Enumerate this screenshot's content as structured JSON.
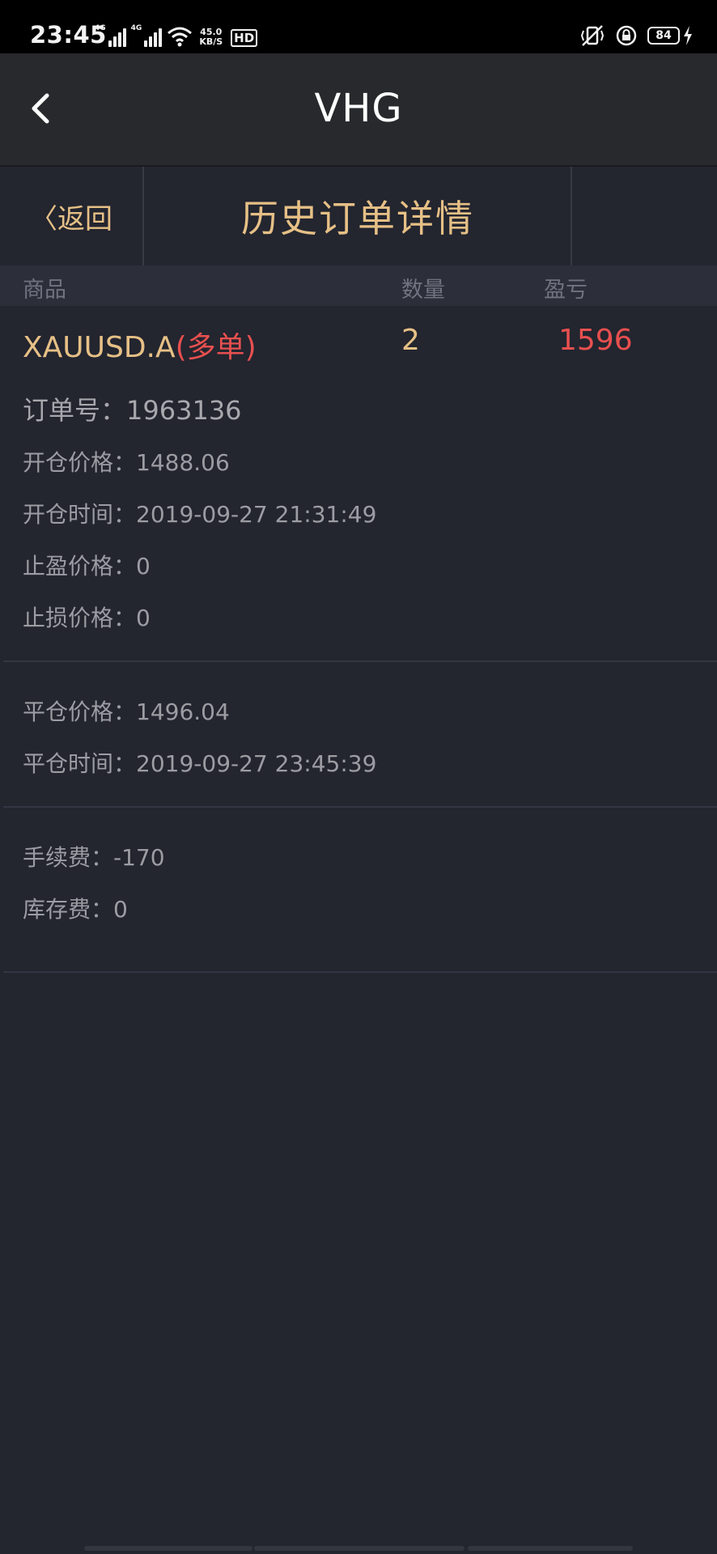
{
  "status_bar": {
    "time": "23:45",
    "signal_label_1": "4G",
    "signal_label_2": "4G",
    "net_speed_value": "45.0",
    "net_speed_unit": "KB/S",
    "hd_label": "HD",
    "battery_level": "84",
    "icons": [
      "signal-icon",
      "signal-icon",
      "wifi-icon",
      "hd-icon",
      "vibrate-icon",
      "lock-rotation-icon",
      "battery-icon",
      "charging-icon"
    ]
  },
  "nav": {
    "title": "VHG",
    "back_icon": "chevron-left-icon"
  },
  "sub_header": {
    "back_label": "〈返回",
    "title": "历史订单详情"
  },
  "columns": {
    "product": "商品",
    "quantity": "数量",
    "pnl": "盈亏"
  },
  "order": {
    "symbol": "XAUUSD.A",
    "direction": "(多单)",
    "quantity": "2",
    "pnl": "1596",
    "order_no_label": "订单号：",
    "order_no": "1963136",
    "open_price_label": "开仓价格：",
    "open_price": "1488.06",
    "open_time_label": "开仓时间：",
    "open_time": "2019-09-27 21:31:49",
    "take_profit_label": "止盈价格：",
    "take_profit": "0",
    "stop_loss_label": "止损价格：",
    "stop_loss": "0",
    "close_price_label": "平仓价格：",
    "close_price": "1496.04",
    "close_time_label": "平仓时间：",
    "close_time": "2019-09-27 23:45:39",
    "commission_label": "手续费：",
    "commission": "-170",
    "storage_label": "库存费：",
    "storage": "0"
  },
  "colors": {
    "background": "#23252f",
    "accent_gold": "#e6c086",
    "loss_red": "#e8504f",
    "nav_bg": "#28292c"
  }
}
